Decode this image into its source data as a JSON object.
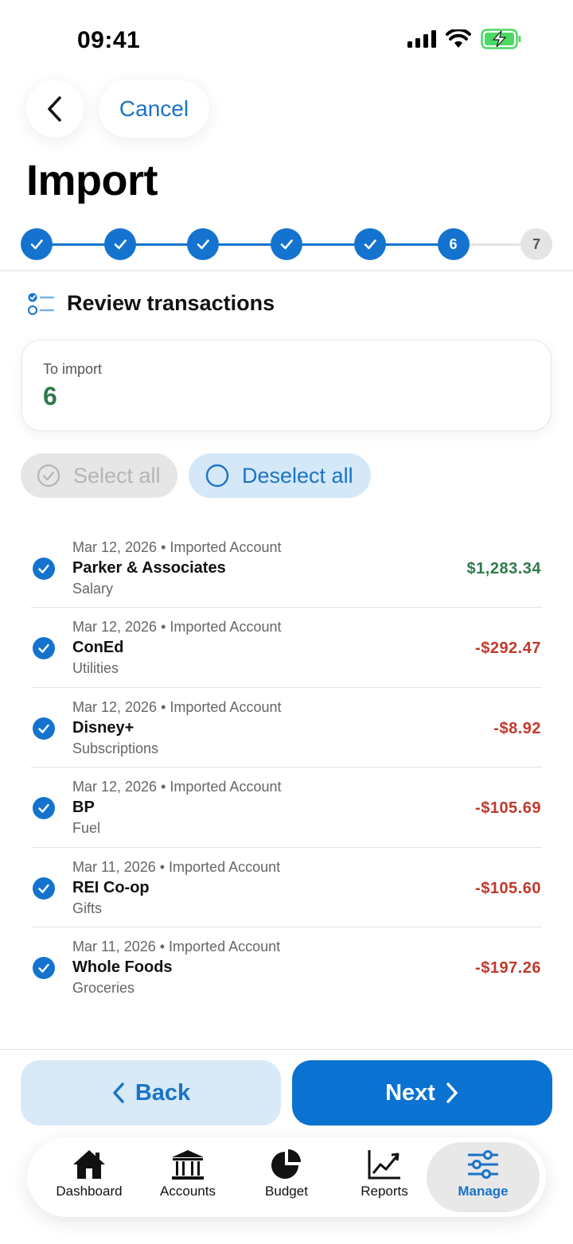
{
  "status_bar": {
    "time": "09:41"
  },
  "header": {
    "cancel_label": "Cancel",
    "title": "Import"
  },
  "stepper": {
    "steps": [
      {
        "state": "done",
        "label": ""
      },
      {
        "state": "done",
        "label": ""
      },
      {
        "state": "done",
        "label": ""
      },
      {
        "state": "done",
        "label": ""
      },
      {
        "state": "done",
        "label": ""
      },
      {
        "state": "current",
        "label": "6"
      },
      {
        "state": "todo",
        "label": "7"
      }
    ]
  },
  "section": {
    "title": "Review transactions"
  },
  "summary": {
    "label": "To import",
    "value": "6"
  },
  "actions": {
    "select_all": "Select all",
    "deselect_all": "Deselect all"
  },
  "transactions": [
    {
      "date": "Mar 12, 2026",
      "account": "Imported Account",
      "payee": "Parker & Associates",
      "category": "Salary",
      "amount": "$1,283.34",
      "type": "income",
      "checked": true
    },
    {
      "date": "Mar 12, 2026",
      "account": "Imported Account",
      "payee": "ConEd",
      "category": "Utilities",
      "amount": "-$292.47",
      "type": "expense",
      "checked": true
    },
    {
      "date": "Mar 12, 2026",
      "account": "Imported Account",
      "payee": "Disney+",
      "category": "Subscriptions",
      "amount": "-$8.92",
      "type": "expense",
      "checked": true
    },
    {
      "date": "Mar 12, 2026",
      "account": "Imported Account",
      "payee": "BP",
      "category": "Fuel",
      "amount": "-$105.69",
      "type": "expense",
      "checked": true
    },
    {
      "date": "Mar 11, 2026",
      "account": "Imported Account",
      "payee": "REI Co-op",
      "category": "Gifts",
      "amount": "-$105.60",
      "type": "expense",
      "checked": true
    },
    {
      "date": "Mar 11, 2026",
      "account": "Imported Account",
      "payee": "Whole Foods",
      "category": "Groceries",
      "amount": "-$197.26",
      "type": "expense",
      "checked": true
    }
  ],
  "footer": {
    "back_label": "Back",
    "next_label": "Next"
  },
  "tabbar": {
    "tabs": [
      {
        "label": "Dashboard",
        "icon": "house-icon",
        "active": false
      },
      {
        "label": "Accounts",
        "icon": "bank-icon",
        "active": false
      },
      {
        "label": "Budget",
        "icon": "pie-chart-icon",
        "active": false
      },
      {
        "label": "Reports",
        "icon": "trend-chart-icon",
        "active": false
      },
      {
        "label": "Manage",
        "icon": "sliders-icon",
        "active": true
      }
    ]
  },
  "colors": {
    "accent": "#1473cf",
    "income": "#2f7a4a",
    "expense": "#c0392b",
    "battery": "#4cd964"
  }
}
